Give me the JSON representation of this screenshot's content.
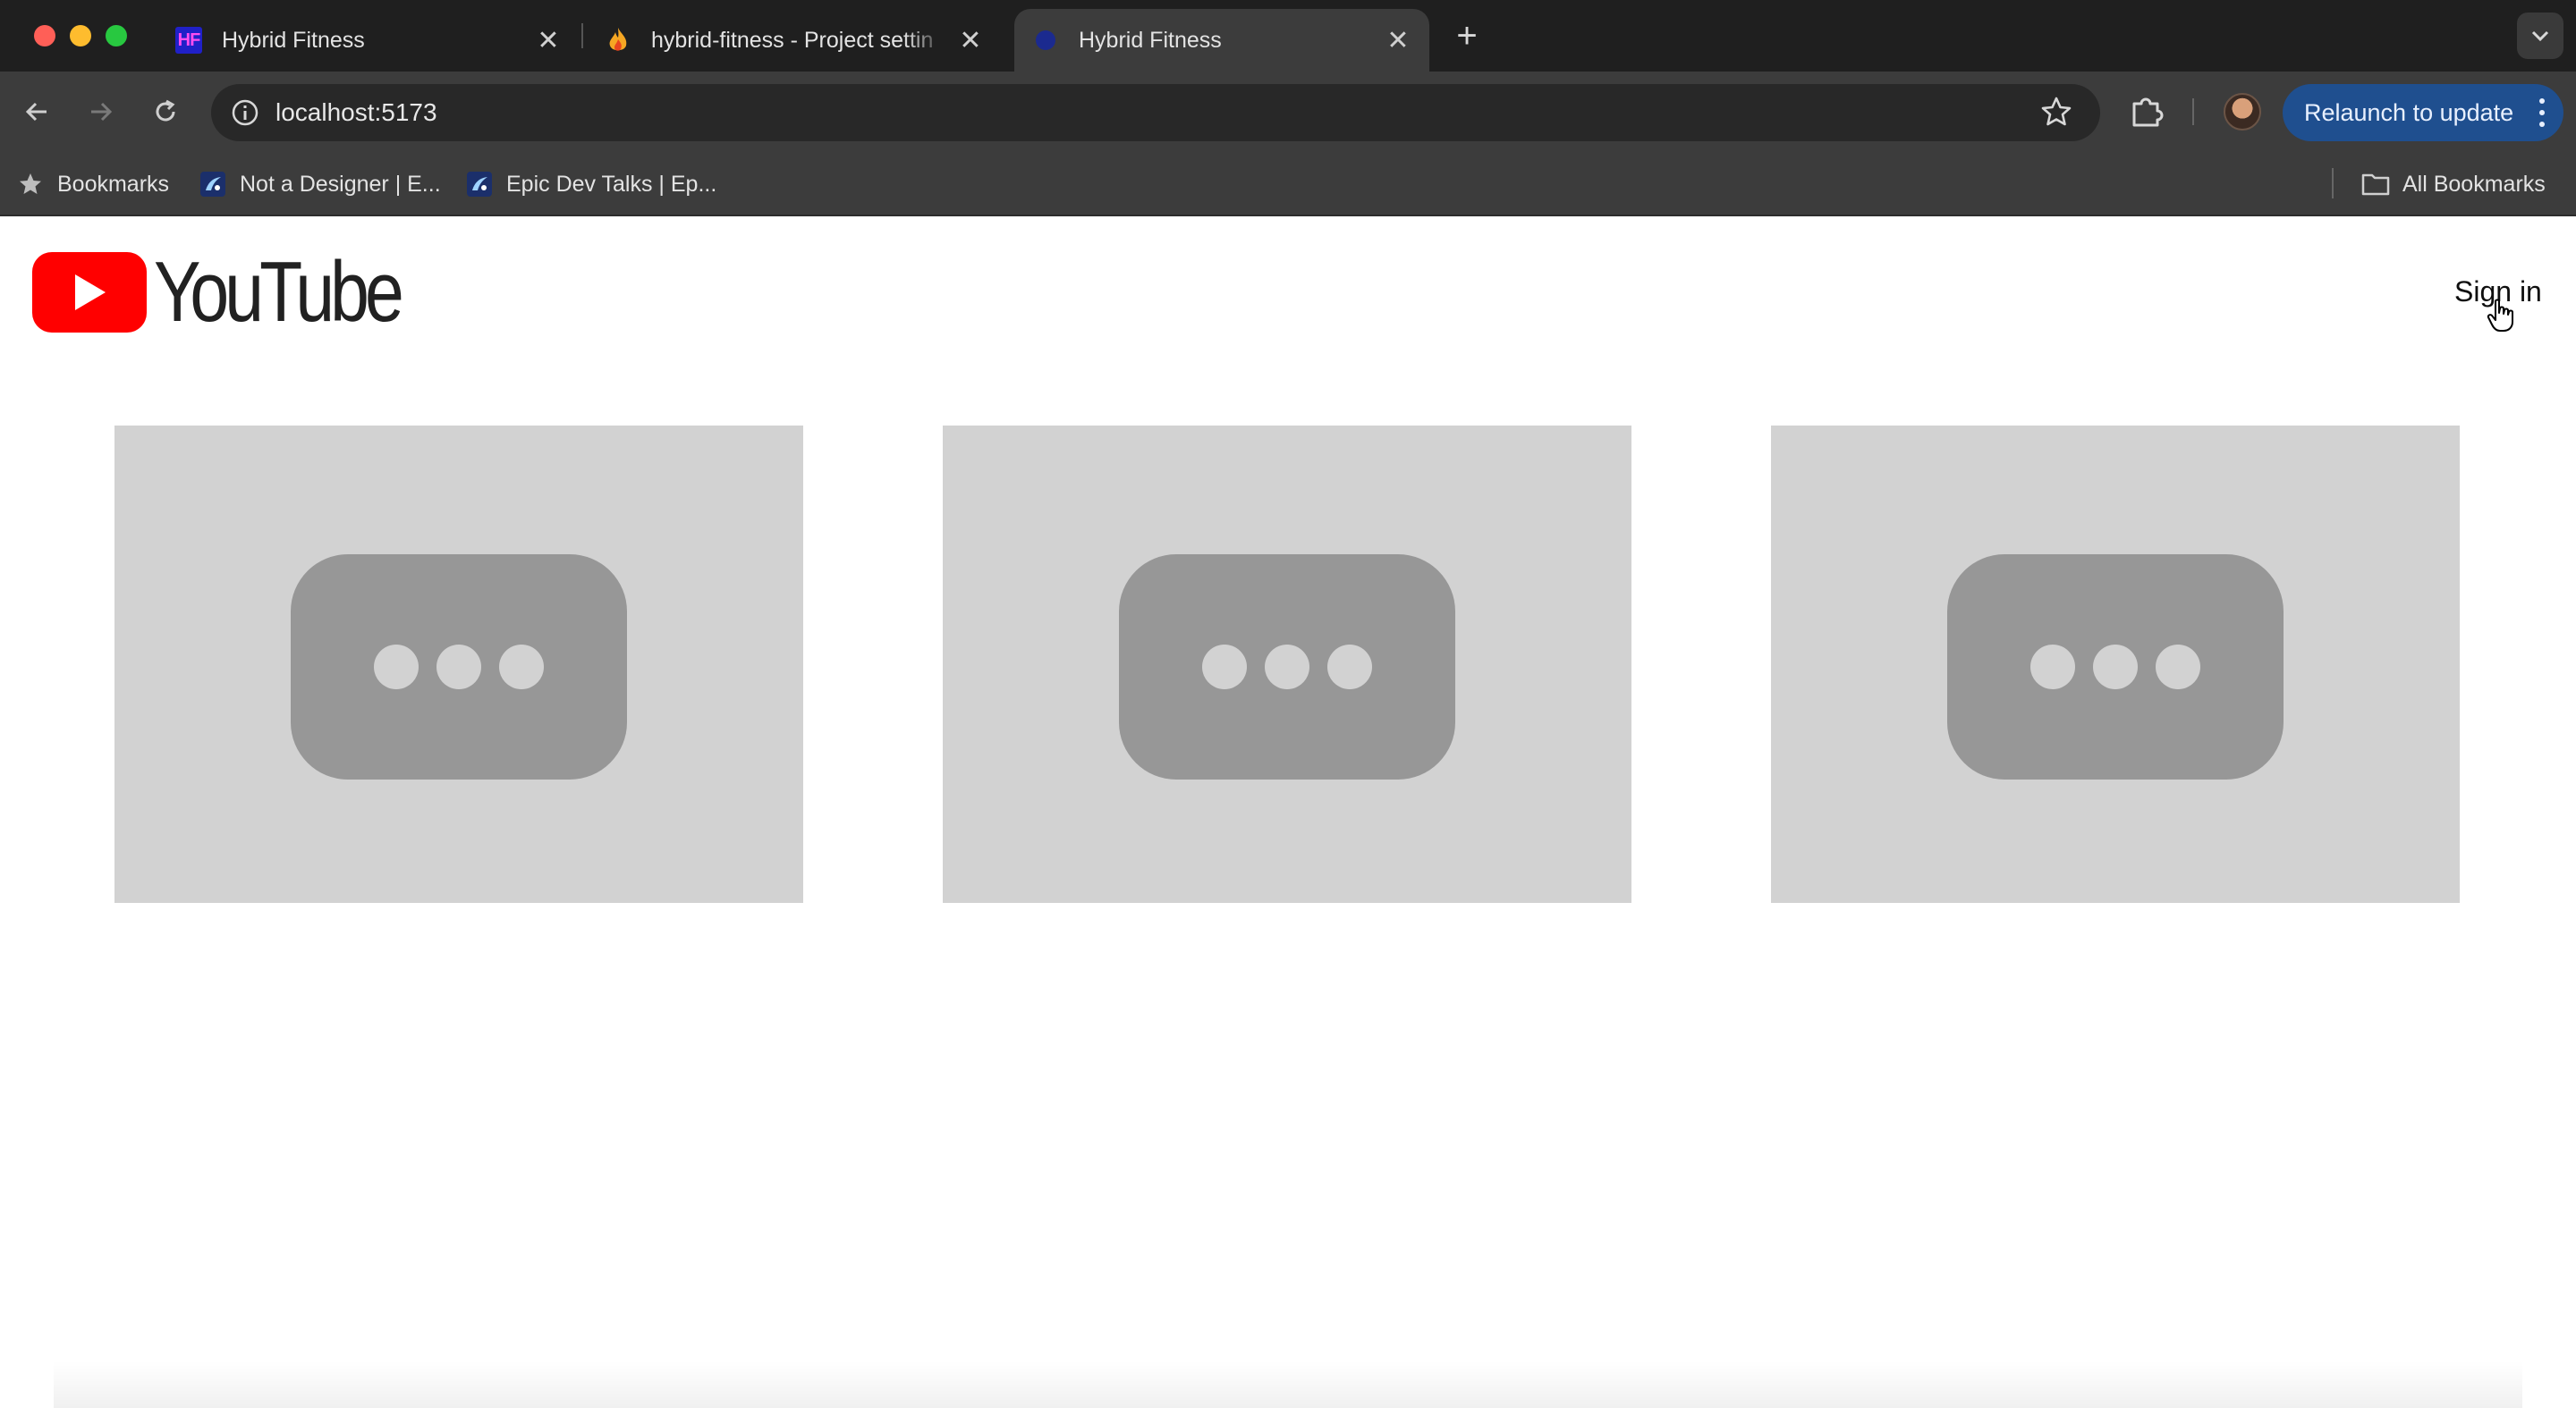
{
  "browser": {
    "tabs": [
      {
        "title": "Hybrid Fitness",
        "favicon": "hf-logo-icon",
        "active": false
      },
      {
        "title": "hybrid-fitness - Project settin",
        "favicon": "firebase-flame-icon",
        "active": false
      },
      {
        "title": "Hybrid Fitness",
        "favicon": "globe-dot-icon",
        "active": true
      }
    ],
    "favicon_text": "HF",
    "url": "localhost:5173",
    "relaunch_label": "Relaunch to update",
    "bookmarks": [
      {
        "label": "Bookmarks",
        "icon": "star-icon"
      },
      {
        "label": "Not a Designer | E...",
        "icon": "epic-logo-icon"
      },
      {
        "label": "Epic Dev Talks | Ep...",
        "icon": "epic-logo-icon"
      }
    ],
    "all_bookmarks_label": "All Bookmarks",
    "colors": {
      "relaunch_bg": "#1f4f8f",
      "chrome_dark": "#1f1f1f",
      "toolbar": "#3c3c3c"
    }
  },
  "page": {
    "logo_text": "YouTube",
    "sign_in_label": "Sign in",
    "cards": [
      {
        "icon": "loading-dots-icon"
      },
      {
        "icon": "loading-dots-icon"
      },
      {
        "icon": "loading-dots-icon"
      }
    ],
    "colors": {
      "youtube_red": "#ff0000",
      "placeholder_bg": "#d2d2d2",
      "placeholder_icon": "#979797"
    }
  }
}
